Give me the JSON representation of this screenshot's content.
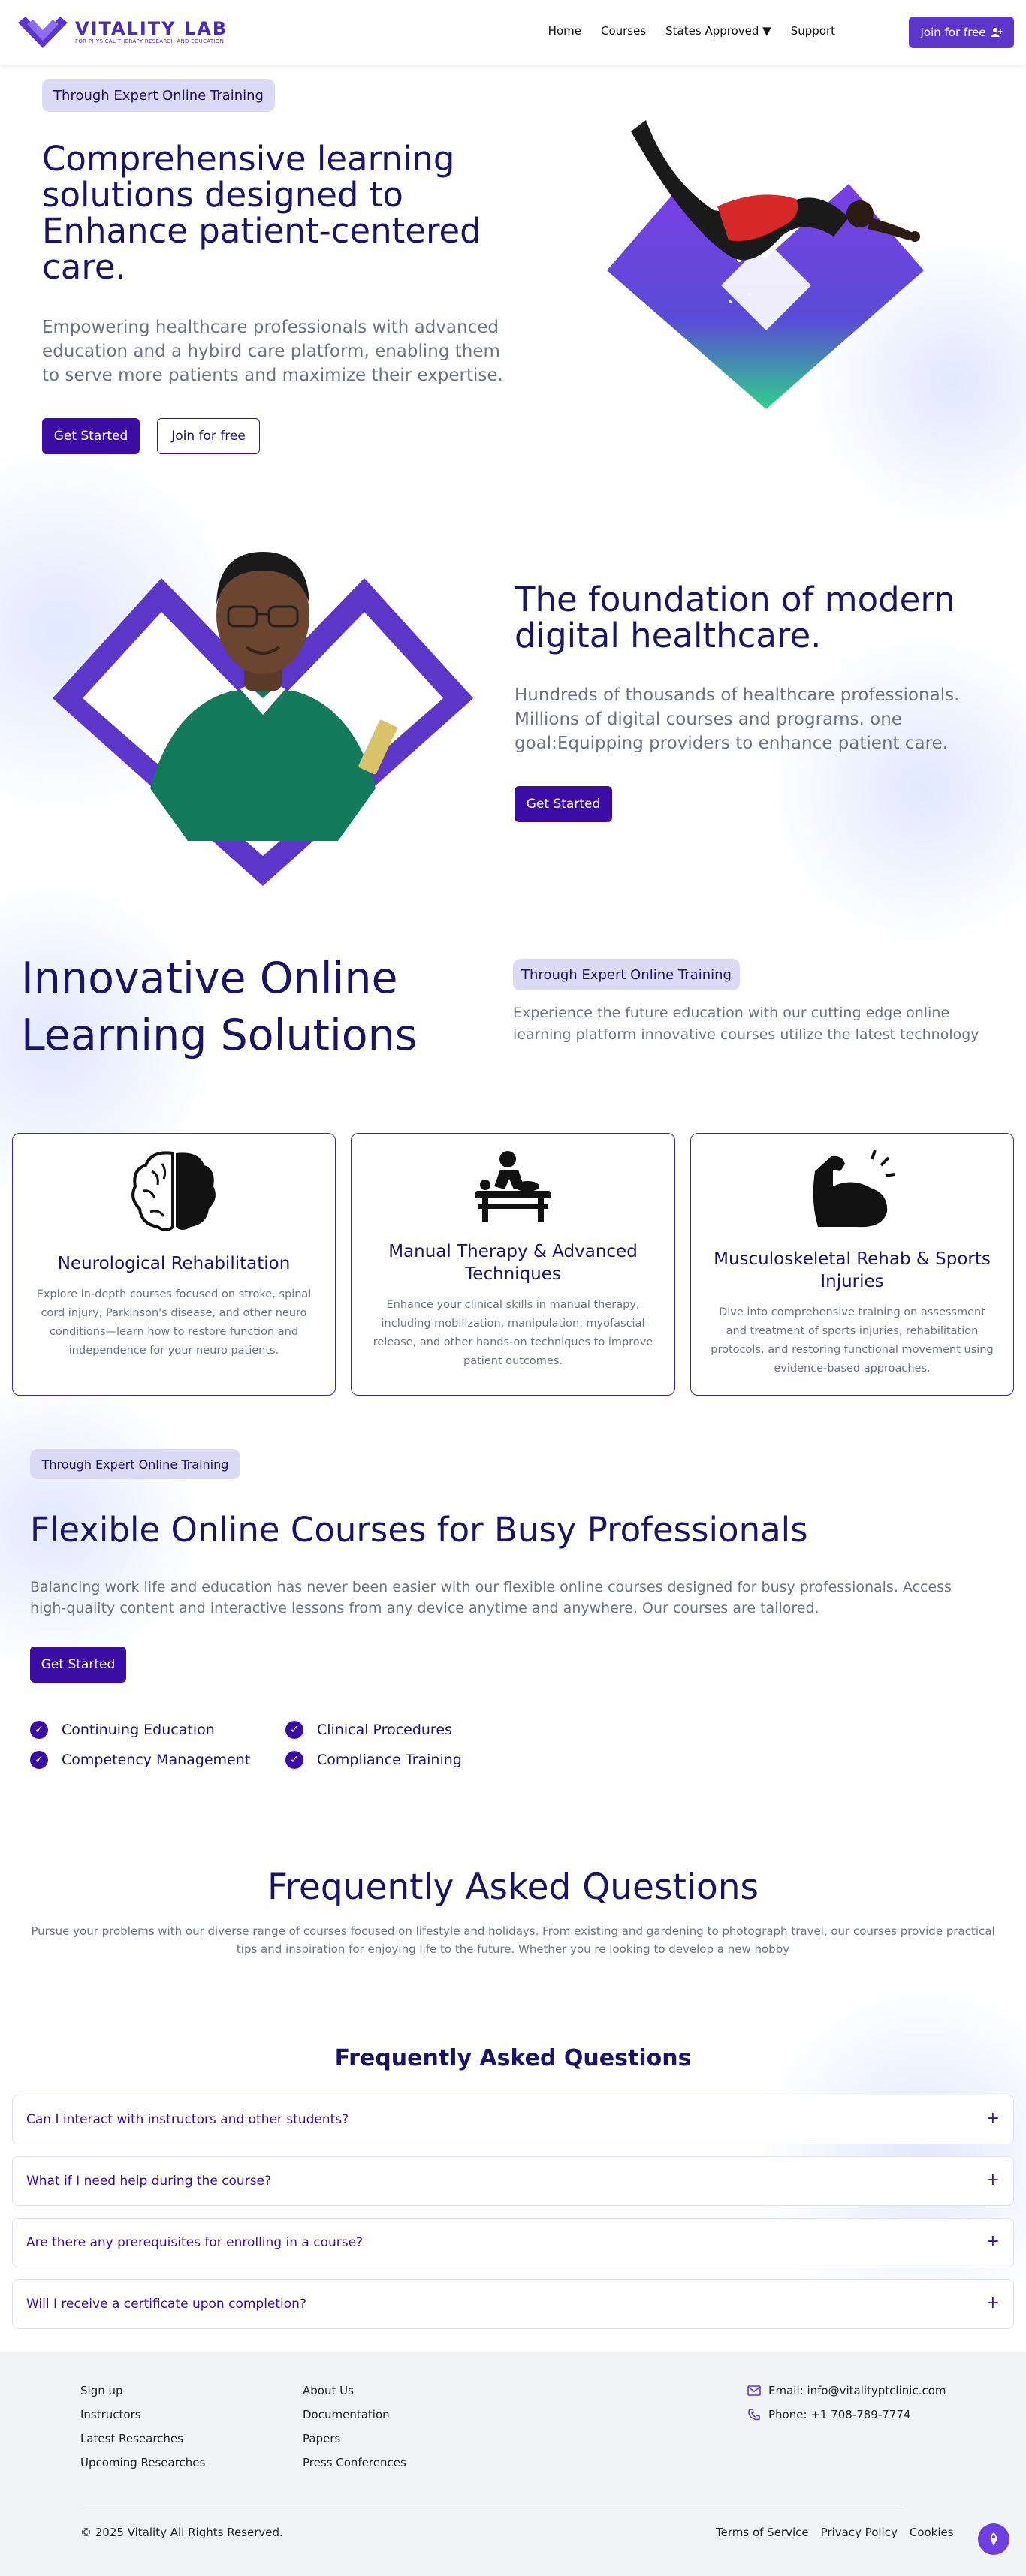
{
  "header": {
    "logo_title": "VITALITY LAB",
    "logo_tagline": "FOR PHYSICAL THERAPY RESEARCH AND EDUCATION",
    "nav": [
      "Home",
      "Courses",
      "States Approved ▼",
      "Support"
    ],
    "join_label": "Join for free"
  },
  "hero": {
    "pill": "Through Expert Online Training",
    "title": "Comprehensive learning solutions designed to Enhance patient-centered care.",
    "subtitle": "Empowering healthcare professionals with advanced education and a hybird care platform, enabling them to serve more patients and maximize their expertise.",
    "primary_button": "Get Started",
    "secondary_button": "Join for free"
  },
  "foundation": {
    "title": "The foundation of modern digital healthcare.",
    "text": "Hundreds of thousands of healthcare professionals. Millions of digital courses and programs. one goal:Equipping providers to enhance patient care.",
    "button": "Get Started"
  },
  "innovative": {
    "title": "Innovative Online Learning Solutions",
    "pill": "Through Expert Online Training",
    "text": "Experience the future education with our cutting edge online learning platform innovative courses utilize the latest technology"
  },
  "cards": [
    {
      "icon": "brain-icon",
      "title": "Neurological Rehabilitation",
      "desc": "Explore in-depth courses focused on stroke, spinal cord injury, Parkinson's disease, and other neuro conditions—learn how to restore function and independence for your neuro patients."
    },
    {
      "icon": "massage-icon",
      "title": "Manual Therapy & Advanced Techniques",
      "desc": "Enhance your clinical skills in manual therapy, including mobilization, manipulation, myofascial release, and other hands-on techniques to improve patient outcomes."
    },
    {
      "icon": "muscle-arm-icon",
      "title": "Musculoskeletal Rehab & Sports Injuries",
      "desc": "Dive into comprehensive training on assessment and treatment of sports injuries, rehabilitation protocols, and restoring functional movement using evidence-based approaches."
    }
  ],
  "flexible": {
    "pill": "Through Expert Online Training",
    "title": "Flexible Online Courses for Busy Professionals",
    "text": "Balancing work life and education has never been easier with our flexible online courses designed for busy professionals. Access high-quality content and interactive lessons from any device anytime and anywhere. Our courses are tailored.",
    "button": "Get Started",
    "features": [
      "Continuing Education",
      "Clinical Procedures",
      "Competency Management",
      "Compliance Training"
    ]
  },
  "faq": {
    "title": "Frequently Asked Questions",
    "text": "Pursue your problems with our diverse range of courses focused on lifestyle and holidays. From existing and gardening to photograph travel, our courses provide practical tips and inspiration for enjoying life to the future. Whether you re looking to develop a new hobby",
    "subtitle": "Frequently Asked Questions",
    "questions": [
      "Can I interact with instructors and other students?",
      "What if I need help during the course?",
      "Are there any prerequisites for enrolling in a course?",
      "Will I receive a certificate upon completion?"
    ]
  },
  "footer": {
    "col1": [
      "Sign up",
      "Instructors",
      "Latest Researches",
      "Upcoming Researches"
    ],
    "col2": [
      "About Us",
      "Documentation",
      "Papers",
      "Press Conferences"
    ],
    "email": "Email: info@vitalityptclinic.com",
    "phone": "Phone: +1 708-789-7774",
    "copyright": "© 2025 Vitality All Rights Reserved.",
    "links": [
      "Terms of Service",
      "Privacy Policy",
      "Cookies"
    ]
  },
  "colors": {
    "primary": "#3a0ca3",
    "accent": "#5b36c9",
    "heading": "#1b1464",
    "pill": "#dcd9f7"
  }
}
